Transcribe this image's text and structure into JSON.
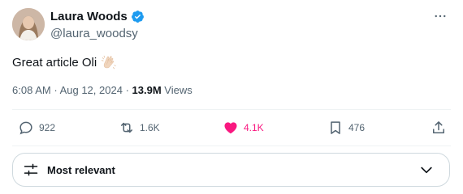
{
  "author": {
    "name": "Laura Woods",
    "handle": "@laura_woodsy"
  },
  "tweet": {
    "text": "Great article Oli",
    "emoji": "clapping-hands-emoji"
  },
  "meta": {
    "time": "6:08 AM",
    "sep1": "·",
    "date": "Aug 12, 2024",
    "sep2": "·",
    "views_count": "13.9M",
    "views_label": "Views"
  },
  "actions": {
    "reply": "922",
    "retweet": "1.6K",
    "like": "4.1K",
    "bookmark": "476"
  },
  "sort": {
    "label": "Most relevant"
  },
  "colors": {
    "like": "#f91880",
    "verified": "#1d9bf0",
    "muted": "#536471",
    "text": "#0f1419"
  }
}
